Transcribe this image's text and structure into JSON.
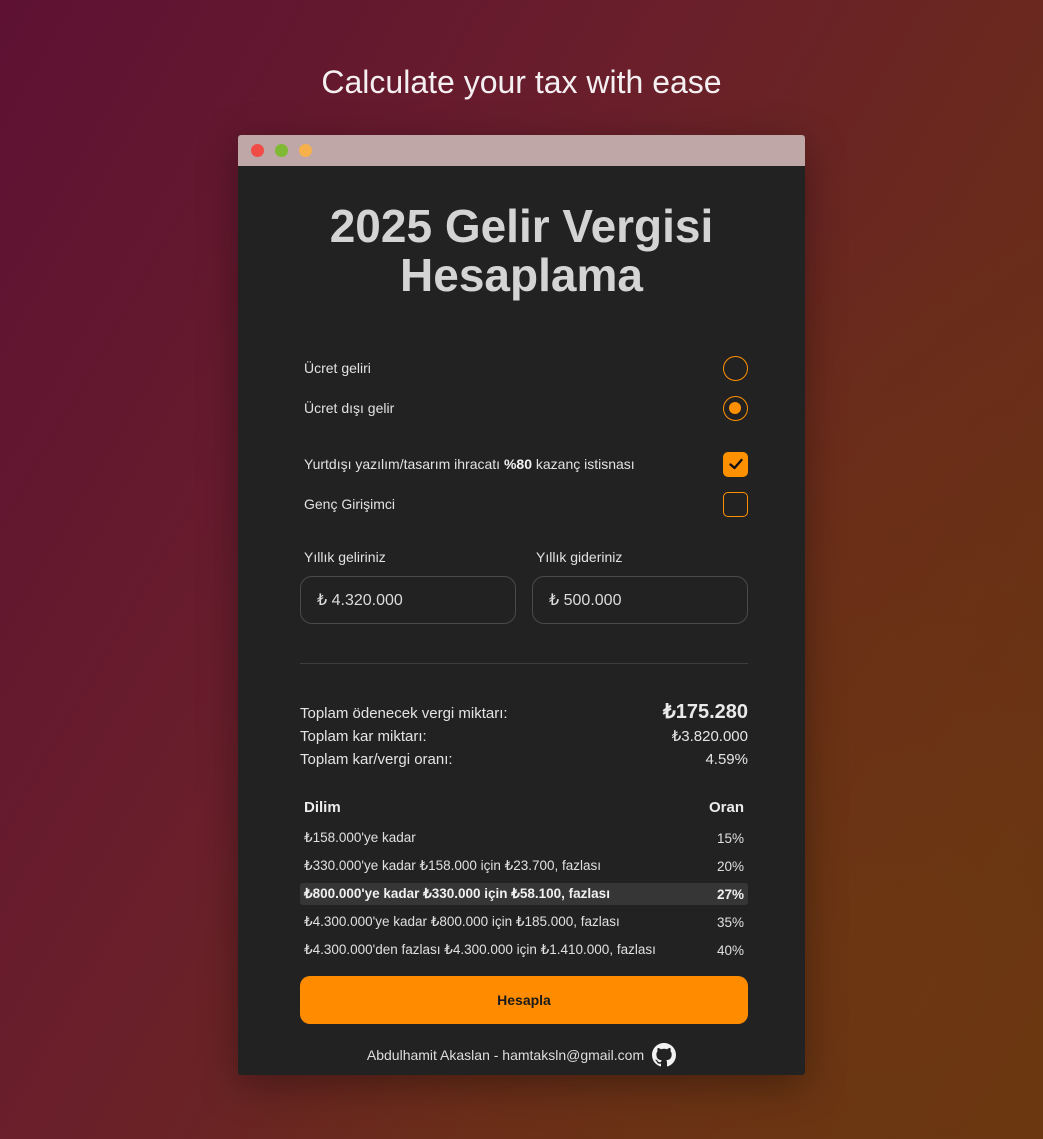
{
  "hero_text": "Calculate your tax with ease",
  "window": {
    "title": "2025 Gelir Vergisi Hesaplama"
  },
  "income_types": [
    {
      "label": "Ücret geliri",
      "selected": false
    },
    {
      "label": "Ücret dışı gelir",
      "selected": true
    }
  ],
  "options": {
    "export_exemption": {
      "prefix": "Yurtdışı yazılım/tasarım ihracatı ",
      "bold": "%80",
      "suffix": " kazanç istisnası",
      "checked": true
    },
    "young_entrepreneur": {
      "label": "Genç Girişimci",
      "checked": false
    }
  },
  "inputs": {
    "income_label": "Yıllık geliriniz",
    "income_value": "₺ 4.320.000",
    "expense_label": "Yıllık gideriniz",
    "expense_value": "₺ 500.000"
  },
  "summary": {
    "tax_label": "Toplam ödenecek vergi miktarı:",
    "tax_value": "₺175.280",
    "profit_label": "Toplam kar miktarı:",
    "profit_value": "₺3.820.000",
    "ratio_label": "Toplam kar/vergi oranı:",
    "ratio_value": "4.59%"
  },
  "brackets": {
    "header_bracket": "Dilim",
    "header_rate": "Oran",
    "rows": [
      {
        "text": "₺158.000'ye kadar",
        "rate": "15%"
      },
      {
        "text": "₺330.000'ye kadar ₺158.000 için ₺23.700, fazlası",
        "rate": "20%"
      },
      {
        "text": "₺800.000'ye kadar ₺330.000 için ₺58.100, fazlası",
        "rate": "27%",
        "active": true
      },
      {
        "text": "₺4.300.000'ye kadar ₺800.000 için ₺185.000, fazlası",
        "rate": "35%"
      },
      {
        "text": "₺4.300.000'den fazlası ₺4.300.000 için ₺1.410.000, fazlası",
        "rate": "40%"
      }
    ]
  },
  "button": {
    "label": "Hesapla"
  },
  "footer": {
    "text": "Abdulhamit Akaslan - hamtaksln@gmail.com",
    "icon": "github-icon"
  },
  "colors": {
    "accent": "#ff8c00",
    "panel": "#222222"
  }
}
